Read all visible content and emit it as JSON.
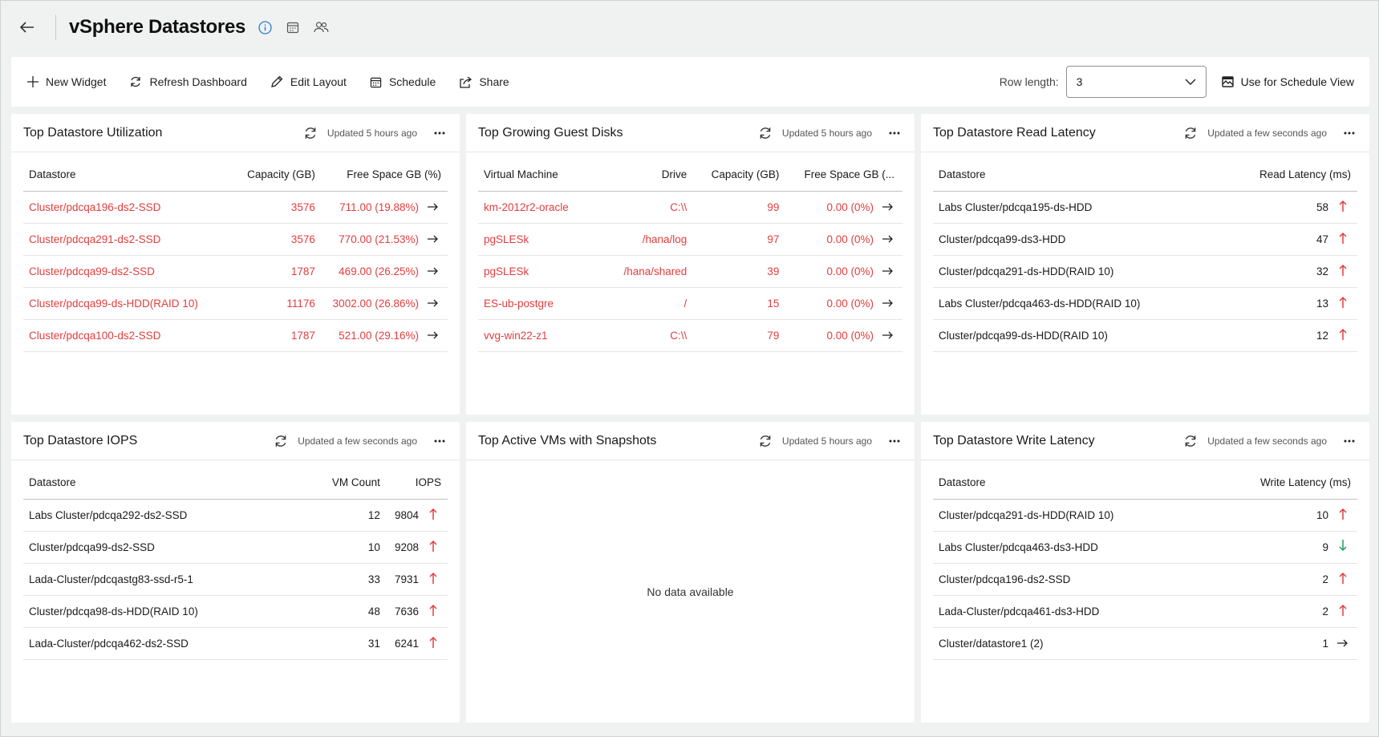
{
  "header": {
    "title": "vSphere Datastores"
  },
  "toolbar": {
    "new_widget": "New Widget",
    "refresh_dashboard": "Refresh Dashboard",
    "edit_layout": "Edit Layout",
    "schedule": "Schedule",
    "share": "Share",
    "row_length_label": "Row length:",
    "row_length_value": "3",
    "schedule_view": "Use for Schedule View"
  },
  "colors": {
    "link_red": "#e23d3d",
    "up_red": "#e23d3d",
    "down_green": "#1e9e5a"
  },
  "widgets": {
    "utilization": {
      "title": "Top Datastore Utilization",
      "updated": "Updated 5 hours ago",
      "columns": [
        "Datastore",
        "Capacity (GB)",
        "Free Space GB (%)"
      ],
      "rows": [
        {
          "name": "Cluster/pdcqa196-ds2-SSD",
          "capacity": "3576",
          "free": "711.00 (19.88%)",
          "trend": "right"
        },
        {
          "name": "Cluster/pdcqa291-ds2-SSD",
          "capacity": "3576",
          "free": "770.00 (21.53%)",
          "trend": "right"
        },
        {
          "name": "Cluster/pdcqa99-ds2-SSD",
          "capacity": "1787",
          "free": "469.00 (26.25%)",
          "trend": "right"
        },
        {
          "name": "Cluster/pdcqa99-ds-HDD(RAID 10)",
          "capacity": "11176",
          "free": "3002.00 (26.86%)",
          "trend": "right"
        },
        {
          "name": "Cluster/pdcqa100-ds2-SSD",
          "capacity": "1787",
          "free": "521.00 (29.16%)",
          "trend": "right"
        }
      ]
    },
    "guest_disks": {
      "title": "Top Growing Guest Disks",
      "updated": "Updated 5 hours ago",
      "columns": [
        "Virtual Machine",
        "Drive",
        "Capacity (GB)",
        "Free Space GB (..."
      ],
      "rows": [
        {
          "vm": "km-2012r2-oracle",
          "drive": "C:\\\\",
          "capacity": "99",
          "free": "0.00 (0%)",
          "trend": "right"
        },
        {
          "vm": "pgSLESk",
          "drive": "/hana/log",
          "capacity": "97",
          "free": "0.00 (0%)",
          "trend": "right"
        },
        {
          "vm": "pgSLESk",
          "drive": "/hana/shared",
          "capacity": "39",
          "free": "0.00 (0%)",
          "trend": "right"
        },
        {
          "vm": "ES-ub-postgre",
          "drive": "/",
          "capacity": "15",
          "free": "0.00 (0%)",
          "trend": "right"
        },
        {
          "vm": "vvg-win22-z1",
          "drive": "C:\\\\",
          "capacity": "79",
          "free": "0.00 (0%)",
          "trend": "right"
        }
      ]
    },
    "read_latency": {
      "title": "Top Datastore Read Latency",
      "updated": "Updated a few seconds ago",
      "columns": [
        "Datastore",
        "Read Latency (ms)"
      ],
      "rows": [
        {
          "name": "Labs Cluster/pdcqa195-ds-HDD",
          "value": "58",
          "trend": "up"
        },
        {
          "name": "Cluster/pdcqa99-ds3-HDD",
          "value": "47",
          "trend": "up"
        },
        {
          "name": "Cluster/pdcqa291-ds-HDD(RAID 10)",
          "value": "32",
          "trend": "up"
        },
        {
          "name": "Labs Cluster/pdcqa463-ds-HDD(RAID 10)",
          "value": "13",
          "trend": "up"
        },
        {
          "name": "Cluster/pdcqa99-ds-HDD(RAID 10)",
          "value": "12",
          "trend": "up"
        }
      ]
    },
    "iops": {
      "title": "Top Datastore IOPS",
      "updated": "Updated a few seconds ago",
      "columns": [
        "Datastore",
        "VM Count",
        "IOPS"
      ],
      "rows": [
        {
          "name": "Labs Cluster/pdcqa292-ds2-SSD",
          "vm_count": "12",
          "iops": "9804",
          "trend": "up"
        },
        {
          "name": "Cluster/pdcqa99-ds2-SSD",
          "vm_count": "10",
          "iops": "9208",
          "trend": "up"
        },
        {
          "name": "Lada-Cluster/pdcqastg83-ssd-r5-1",
          "vm_count": "33",
          "iops": "7931",
          "trend": "up"
        },
        {
          "name": "Cluster/pdcqa98-ds-HDD(RAID 10)",
          "vm_count": "48",
          "iops": "7636",
          "trend": "up"
        },
        {
          "name": "Lada-Cluster/pdcqa462-ds2-SSD",
          "vm_count": "31",
          "iops": "6241",
          "trend": "up"
        }
      ]
    },
    "snapshots": {
      "title": "Top Active VMs with Snapshots",
      "updated": "Updated 5 hours ago",
      "empty_text": "No data available"
    },
    "write_latency": {
      "title": "Top Datastore Write Latency",
      "updated": "Updated a few seconds ago",
      "columns": [
        "Datastore",
        "Write Latency (ms)"
      ],
      "rows": [
        {
          "name": "Cluster/pdcqa291-ds-HDD(RAID 10)",
          "value": "10",
          "trend": "up"
        },
        {
          "name": "Labs Cluster/pdcqa463-ds3-HDD",
          "value": "9",
          "trend": "down"
        },
        {
          "name": "Cluster/pdcqa196-ds2-SSD",
          "value": "2",
          "trend": "up"
        },
        {
          "name": "Lada-Cluster/pdcqa461-ds3-HDD",
          "value": "2",
          "trend": "up"
        },
        {
          "name": "Cluster/datastore1 (2)",
          "value": "1",
          "trend": "right"
        }
      ]
    }
  }
}
